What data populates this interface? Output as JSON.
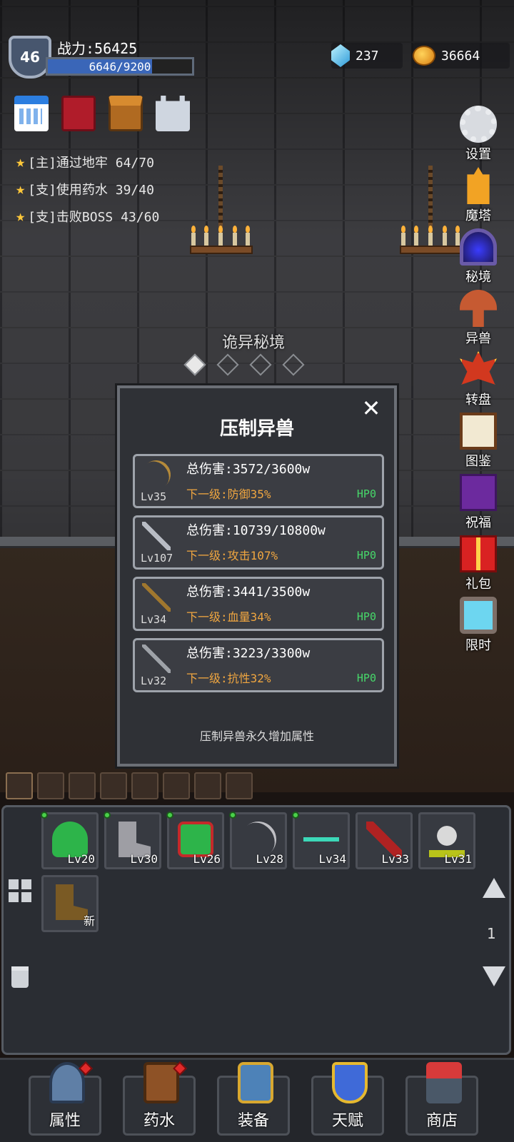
{
  "player": {
    "level": "46",
    "power_label": "战力:56425",
    "hp_text": "6646/9200",
    "hp_fraction": 0.7224
  },
  "currency": {
    "gems": "237",
    "gold": "36664"
  },
  "top_icons": [
    "calendar-icon",
    "spellbook-icon",
    "treasure-chest-icon",
    "castle-icon"
  ],
  "quests": [
    {
      "text": "[主]通过地牢 64/70"
    },
    {
      "text": "[支]使用药水 39/40"
    },
    {
      "text": "[支]击败BOSS 43/60"
    }
  ],
  "right_menu": [
    {
      "label": "设置",
      "icon": "gear-icon"
    },
    {
      "label": "魔塔",
      "icon": "magic-tower-icon"
    },
    {
      "label": "秘境",
      "icon": "portal-icon"
    },
    {
      "label": "异兽",
      "icon": "mushroom-icon"
    },
    {
      "label": "转盘",
      "icon": "wheel-icon"
    },
    {
      "label": "图鉴",
      "icon": "open-book-icon"
    },
    {
      "label": "祝福",
      "icon": "blessing-tome-icon"
    },
    {
      "label": "礼包",
      "icon": "gift-icon"
    },
    {
      "label": "限时",
      "icon": "tv-icon"
    }
  ],
  "stage": {
    "title": "诡异秘境"
  },
  "modal": {
    "title": "压制异兽",
    "close": "✕",
    "note": "压制异兽永久增加属性",
    "cards": [
      {
        "level": "Lv35",
        "damage": "总伤害:3572/3600w",
        "next": "下一级:防御35%",
        "hp": "HP0",
        "icon": "bow-icon"
      },
      {
        "level": "Lv107",
        "damage": "总伤害:10739/10800w",
        "next": "下一级:攻击107%",
        "hp": "HP0",
        "icon": "sword-icon"
      },
      {
        "level": "Lv34",
        "damage": "总伤害:3441/3500w",
        "next": "下一级:血量34%",
        "hp": "HP0",
        "icon": "staff-icon"
      },
      {
        "level": "Lv32",
        "damage": "总伤害:3223/3300w",
        "next": "下一级:抗性32%",
        "hp": "HP0",
        "icon": "dagger-icon"
      }
    ]
  },
  "inventory": {
    "page": "1",
    "slots": [
      {
        "level": "Lv20",
        "icon": "hood-icon"
      },
      {
        "level": "Lv30",
        "icon": "boot-icon"
      },
      {
        "level": "Lv26",
        "icon": "armor-icon"
      },
      {
        "level": "Lv28",
        "icon": "bow-icon"
      },
      {
        "level": "Lv34",
        "icon": "key-icon"
      },
      {
        "level": "Lv33",
        "icon": "blade-icon"
      },
      {
        "level": "Lv31",
        "icon": "helmet-icon"
      },
      {
        "level": "新",
        "icon": "boot-icon"
      }
    ]
  },
  "bottom_nav": [
    {
      "label": "属性",
      "icon": "helmet-icon"
    },
    {
      "label": "药水",
      "icon": "bag-icon"
    },
    {
      "label": "装备",
      "icon": "armor-icon"
    },
    {
      "label": "天赋",
      "icon": "shield-icon"
    },
    {
      "label": "商店",
      "icon": "shop-icon"
    }
  ]
}
